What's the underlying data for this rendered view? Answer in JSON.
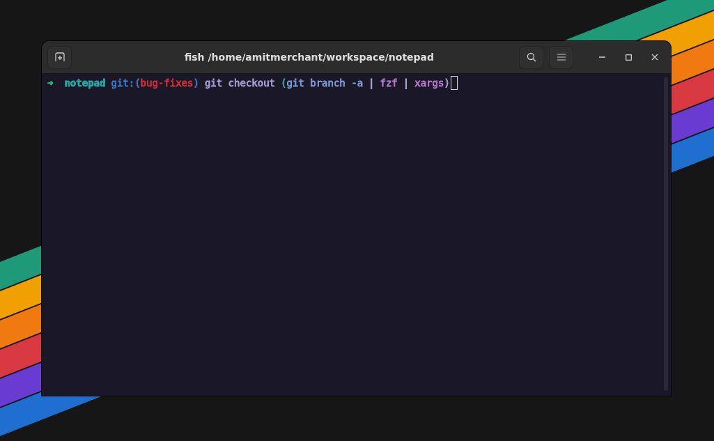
{
  "window": {
    "title": "fish /home/amitmerchant/workspace/notepad"
  },
  "terminal": {
    "prompt": [
      {
        "segments": [
          {
            "text": "➜",
            "color": "#2fb38a"
          }
        ]
      },
      {
        "segments": [
          {
            "text": "notepad",
            "color": "#2aa7a7"
          }
        ]
      },
      {
        "segments": [
          {
            "text": "git:(",
            "color": "#3f78c8"
          },
          {
            "text": "bug-fixes",
            "color": "#d0323a"
          },
          {
            "text": ")",
            "color": "#3f78c8"
          }
        ]
      },
      {
        "segments": [
          {
            "text": "git checkout",
            "color": "#a99fd8"
          }
        ]
      },
      {
        "segments": [
          {
            "text": "(",
            "color": "#2aa7a7"
          },
          {
            "text": "git branch -a",
            "color": "#7f9ad8"
          }
        ]
      },
      {
        "segments": [
          {
            "text": "|",
            "color": "#b8b0e8"
          }
        ]
      },
      {
        "segments": [
          {
            "text": "fzf",
            "color": "#b77bd0"
          }
        ]
      },
      {
        "segments": [
          {
            "text": "|",
            "color": "#b8b0e8"
          }
        ]
      },
      {
        "segments": [
          {
            "text": "xargs",
            "color": "#b77bd0"
          },
          {
            "text": ")",
            "color": "#a99fd8"
          }
        ]
      }
    ]
  }
}
